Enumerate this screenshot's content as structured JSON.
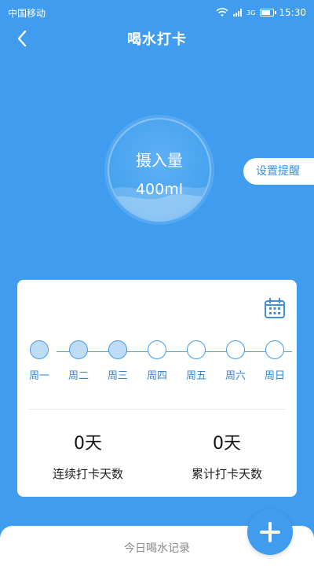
{
  "status_bar": {
    "carrier": "中国移动",
    "network": "3G",
    "time": "15:30"
  },
  "header": {
    "title": "喝水打卡"
  },
  "intake": {
    "label": "摄入量",
    "value": "400ml"
  },
  "reminder_button": "设置提醒",
  "week": {
    "days": [
      {
        "label": "周一",
        "checked": true
      },
      {
        "label": "周二",
        "checked": true
      },
      {
        "label": "周三",
        "checked": true
      },
      {
        "label": "周四",
        "checked": false
      },
      {
        "label": "周五",
        "checked": false
      },
      {
        "label": "周六",
        "checked": false
      },
      {
        "label": "周日",
        "checked": false
      }
    ]
  },
  "stats": {
    "consecutive": {
      "value": "0天",
      "label": "连续打卡天数"
    },
    "total": {
      "value": "0天",
      "label": "累计打卡天数"
    }
  },
  "records": {
    "title": "今日喝水记录"
  },
  "colors": {
    "primary": "#3f9cef",
    "checked_fill": "#bfdcf7"
  }
}
